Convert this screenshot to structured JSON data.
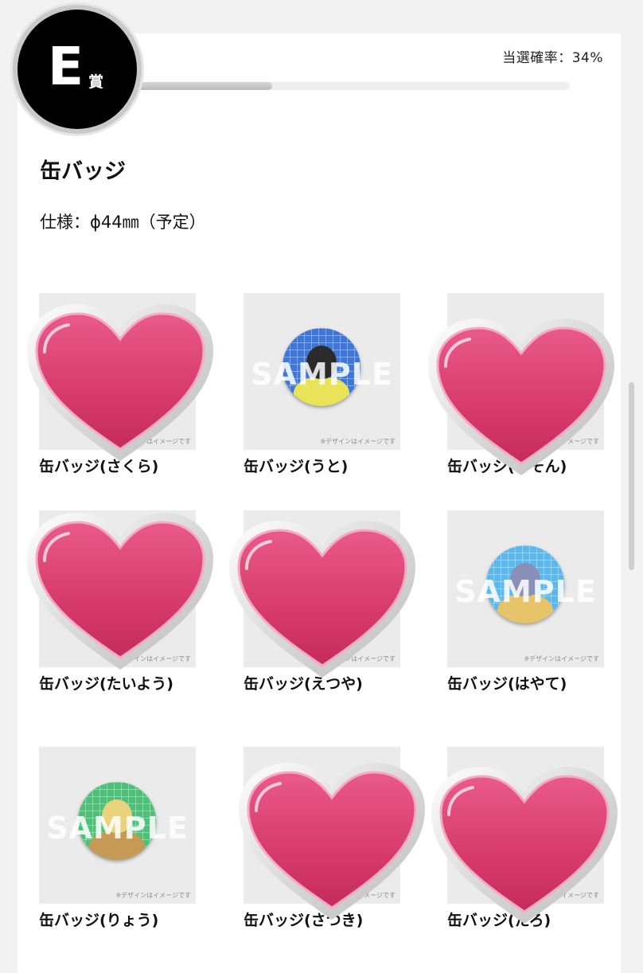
{
  "prize": {
    "letter": "E",
    "kanji": "賞",
    "rate_label": "当選確率：34%",
    "rate_value": 0.34
  },
  "product": {
    "title": "缶バッジ",
    "spec": "仕様：ϕ44㎜（予定）"
  },
  "thumb_common": {
    "watermark": "SAMPLE",
    "note": "※デザインはイメージです"
  },
  "items": [
    {
      "label": "缶バッジ(さくら)"
    },
    {
      "label": "缶バッジ(うと)",
      "badge_bg": "#3f77d8",
      "hair": "#2b2b2b",
      "cloth": "#e9e35a"
    },
    {
      "label": "缶バッジ(ゆそん)"
    },
    {
      "label": "缶バッジ(たいよう)"
    },
    {
      "label": "缶バッジ(えつや)"
    },
    {
      "label": "缶バッジ(はやて)",
      "badge_bg": "#5cb8ec",
      "hair": "#8a8fb8",
      "cloth": "#e7c46a"
    },
    {
      "label": "缶バッジ(りょう)",
      "badge_bg": "#4fc07a",
      "hair": "#e8d27c",
      "cloth": "#c59a55"
    },
    {
      "label": "缶バッジ(さつき)"
    },
    {
      "label": "缶バッジ(たろ)"
    }
  ],
  "colors": {
    "heart": "#e0487a",
    "heart_dark": "#b82858",
    "badge": "#000000"
  }
}
